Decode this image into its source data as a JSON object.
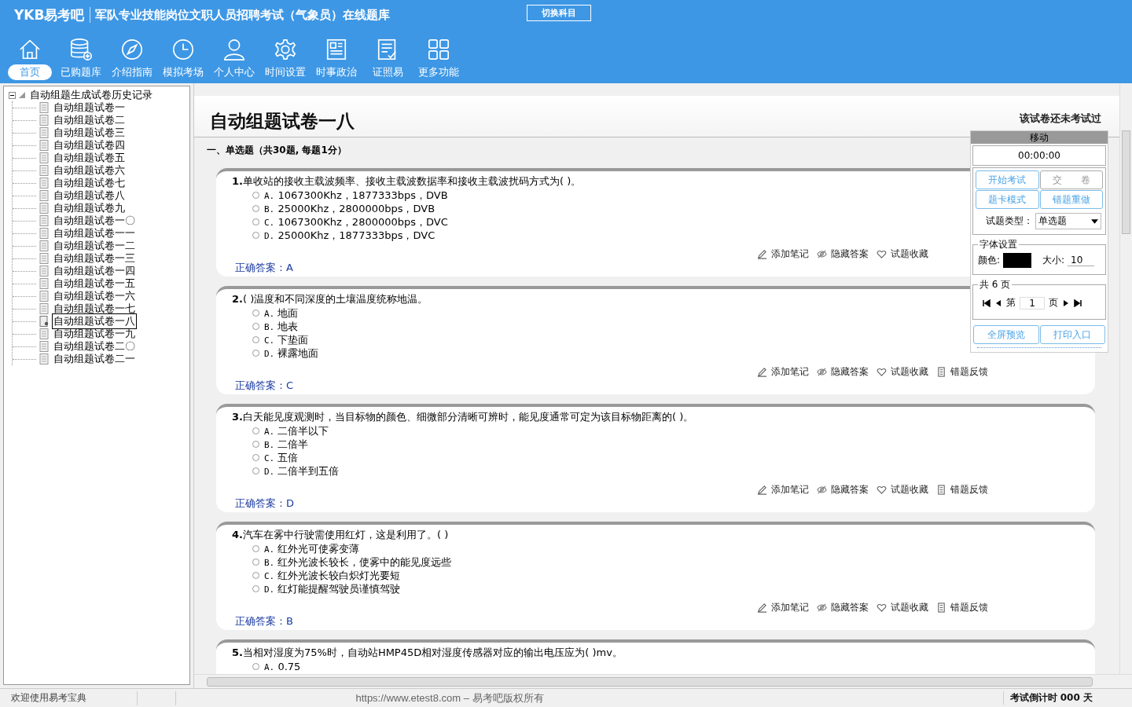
{
  "app": {
    "logo": "YKB易考吧",
    "title": "军队专业技能岗位文职人员招聘考试（气象员）在线题库",
    "switch_button": "切换科目"
  },
  "nav": [
    {
      "label": "首页",
      "kind": "home",
      "selected": true
    },
    {
      "label": "已购题库",
      "kind": "database",
      "selected": false
    },
    {
      "label": "介绍指南",
      "kind": "compass",
      "selected": false
    },
    {
      "label": "模拟考场",
      "kind": "clock",
      "selected": false
    },
    {
      "label": "个人中心",
      "kind": "person",
      "selected": false
    },
    {
      "label": "时间设置",
      "kind": "gear",
      "selected": false
    },
    {
      "label": "时事政治",
      "kind": "newspaper",
      "selected": false
    },
    {
      "label": "证照易",
      "kind": "checklist",
      "selected": false
    },
    {
      "label": "更多功能",
      "kind": "grid",
      "selected": false
    }
  ],
  "tree": {
    "root": "自动组题生成试卷历史记录",
    "expanded": true,
    "children": [
      {
        "label": "自动组题试卷一",
        "selected": false
      },
      {
        "label": "自动组题试卷二",
        "selected": false
      },
      {
        "label": "自动组题试卷三",
        "selected": false
      },
      {
        "label": "自动组题试卷四",
        "selected": false
      },
      {
        "label": "自动组题试卷五",
        "selected": false
      },
      {
        "label": "自动组题试卷六",
        "selected": false
      },
      {
        "label": "自动组题试卷七",
        "selected": false
      },
      {
        "label": "自动组题试卷八",
        "selected": false
      },
      {
        "label": "自动组题试卷九",
        "selected": false
      },
      {
        "label": "自动组题试卷一〇",
        "selected": false
      },
      {
        "label": "自动组题试卷一一",
        "selected": false
      },
      {
        "label": "自动组题试卷一二",
        "selected": false
      },
      {
        "label": "自动组题试卷一三",
        "selected": false
      },
      {
        "label": "自动组题试卷一四",
        "selected": false
      },
      {
        "label": "自动组题试卷一五",
        "selected": false
      },
      {
        "label": "自动组题试卷一六",
        "selected": false
      },
      {
        "label": "自动组题试卷一七",
        "selected": false
      },
      {
        "label": "自动组题试卷一八",
        "selected": true
      },
      {
        "label": "自动组题试卷一九",
        "selected": false
      },
      {
        "label": "自动组题试卷二〇",
        "selected": false
      },
      {
        "label": "自动组题试卷二一",
        "selected": false
      }
    ]
  },
  "paper": {
    "title": "自动组题试卷一八",
    "status": "该试卷还未考试过",
    "section": "一、单选题（共30题, 每题1分）",
    "questions": [
      {
        "number": "1.",
        "text": "单收站的接收主载波频率、接收主载波数据率和接收主载波扰码方式为( )。",
        "options": [
          {
            "letter": "A.",
            "text": "1067300Khz，1877333bps，DVB",
            "selected": false
          },
          {
            "letter": "B.",
            "text": "25000Khz，2800000bps，DVB",
            "selected": false
          },
          {
            "letter": "C.",
            "text": "1067300Khz，2800000bps，DVC",
            "selected": false
          },
          {
            "letter": "D.",
            "text": "25000Khz，1877333bps，DVC",
            "selected": false
          }
        ],
        "answer_label": "正确答案：",
        "answer": "A",
        "actions": [
          "添加笔记",
          "隐藏答案",
          "试题收藏"
        ]
      },
      {
        "number": "2.",
        "text": "( )温度和不同深度的土壤温度统称地温。",
        "options": [
          {
            "letter": "A.",
            "text": "地面",
            "selected": false
          },
          {
            "letter": "B.",
            "text": "地表",
            "selected": false
          },
          {
            "letter": "C.",
            "text": "下垫面",
            "selected": false
          },
          {
            "letter": "D.",
            "text": "裸露地面",
            "selected": false
          }
        ],
        "answer_label": "正确答案：",
        "answer": "C",
        "actions": [
          "添加笔记",
          "隐藏答案",
          "试题收藏",
          "错题反馈"
        ]
      },
      {
        "number": "3.",
        "text": "白天能见度观测时，当目标物的颜色、细微部分清晰可辨时，能见度通常可定为该目标物距离的( )。",
        "options": [
          {
            "letter": "A.",
            "text": "二倍半以下",
            "selected": false
          },
          {
            "letter": "B.",
            "text": "二倍半",
            "selected": false
          },
          {
            "letter": "C.",
            "text": "五倍",
            "selected": false
          },
          {
            "letter": "D.",
            "text": "二倍半到五倍",
            "selected": false
          }
        ],
        "answer_label": "正确答案：",
        "answer": "D",
        "actions": [
          "添加笔记",
          "隐藏答案",
          "试题收藏",
          "错题反馈"
        ]
      },
      {
        "number": "4.",
        "text": "汽车在雾中行驶需使用红灯，这是利用了。( )",
        "options": [
          {
            "letter": "A.",
            "text": "红外光可使雾变薄",
            "selected": false
          },
          {
            "letter": "B.",
            "text": "红外光波长较长，使雾中的能见度远些",
            "selected": false
          },
          {
            "letter": "C.",
            "text": "红外光波长较白炽灯光要短",
            "selected": false
          },
          {
            "letter": "D.",
            "text": "红灯能提醒驾驶员谨慎驾驶",
            "selected": false
          }
        ],
        "answer_label": "正确答案：",
        "answer": "B",
        "actions": [
          "添加笔记",
          "隐藏答案",
          "试题收藏",
          "错题反馈"
        ]
      },
      {
        "number": "5.",
        "text": "当相对湿度为75%时，自动站HMP45D相对湿度传感器对应的输出电压应为( )mv。",
        "options": [
          {
            "letter": "A.",
            "text": "0.75",
            "selected": false
          }
        ]
      }
    ]
  },
  "panel": {
    "handle": "移动",
    "timer": "00:00:00",
    "buttons": [
      {
        "label": "开始考试",
        "disabled": false
      },
      {
        "label": "交　　卷",
        "disabled": true
      },
      {
        "label": "题卡模式",
        "disabled": false
      },
      {
        "label": "错题重做",
        "disabled": false
      }
    ],
    "type_label": "试题类型：",
    "type_value": "单选题",
    "font": {
      "legend": "字体设置",
      "color_label": "颜色:",
      "color": "#000000",
      "size_label": "大小:",
      "size": "10"
    },
    "pager": {
      "legend": "共 6 页",
      "prefix": "第",
      "page": "1",
      "suffix": "页"
    },
    "bottom_buttons": [
      {
        "label": "全屏预览",
        "disabled": false
      },
      {
        "label": "打印入口",
        "disabled": false
      }
    ]
  },
  "status_bar": {
    "left": "欢迎使用易考宝典",
    "center": "https://www.etest8.com – 易考吧版权所有",
    "right": "考试倒计时 000 天"
  }
}
